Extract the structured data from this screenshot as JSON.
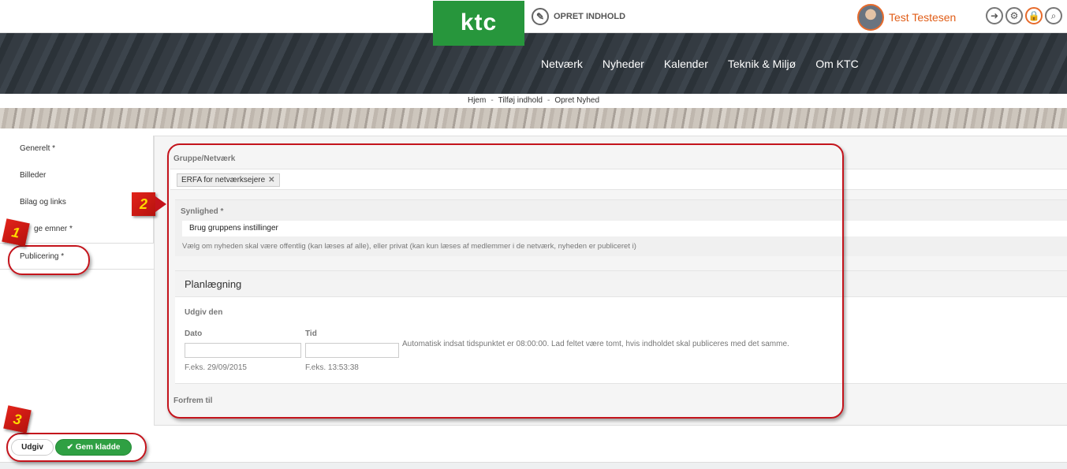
{
  "header": {
    "logo": "ktc",
    "create_content": "OPRET INDHOLD",
    "user_name": "Test Testesen",
    "icons": [
      "pin-icon",
      "gear-icon",
      "lock-icon",
      "search-icon"
    ]
  },
  "nav": {
    "items": [
      "Netværk",
      "Nyheder",
      "Kalender",
      "Teknik & Miljø",
      "Om KTC"
    ]
  },
  "breadcrumb": {
    "items": [
      "Hjem",
      "Tilføj indhold",
      "Opret Nyhed"
    ],
    "separator": "-"
  },
  "sidebar": {
    "items": [
      {
        "label": "Generelt *"
      },
      {
        "label": "Billeder"
      },
      {
        "label": "Bilag og links"
      },
      {
        "label": "ge emner *"
      },
      {
        "label": "Publicering *"
      }
    ]
  },
  "form": {
    "group_label": "Gruppe/Netværk",
    "group_tag": "ERFA for netværksejere",
    "tag_remove": "✕",
    "visibility_label": "Synlighed *",
    "visibility_value": "Brug gruppens instillinger",
    "visibility_help": "Vælg om nyheden skal være offentlig (kan læses af alle), eller privat (kan kun læses af medlemmer i de netværk, nyheden er publiceret i)",
    "planning_title": "Planlægning",
    "publish_label": "Udgiv den",
    "date_label": "Dato",
    "time_label": "Tid",
    "date_hint": "F.eks. 29/09/2015",
    "time_hint": "F.eks. 13:53:38",
    "auto_time_help": "Automatisk indsat tidspunktet er 08:00:00. Lad feltet være tomt, hvis indholdet skal publiceres med det samme.",
    "promote_label": "Forfrem til"
  },
  "buttons": {
    "publish": "Udgiv",
    "save_draft": "Gem kladde",
    "save_icon": "✔"
  },
  "annotations": [
    "1",
    "2",
    "3"
  ],
  "colors": {
    "brand_green": "#27963c",
    "user_orange": "#e05d17",
    "annotation_red": "#c4141c",
    "annotation_number": "#ffd900"
  }
}
